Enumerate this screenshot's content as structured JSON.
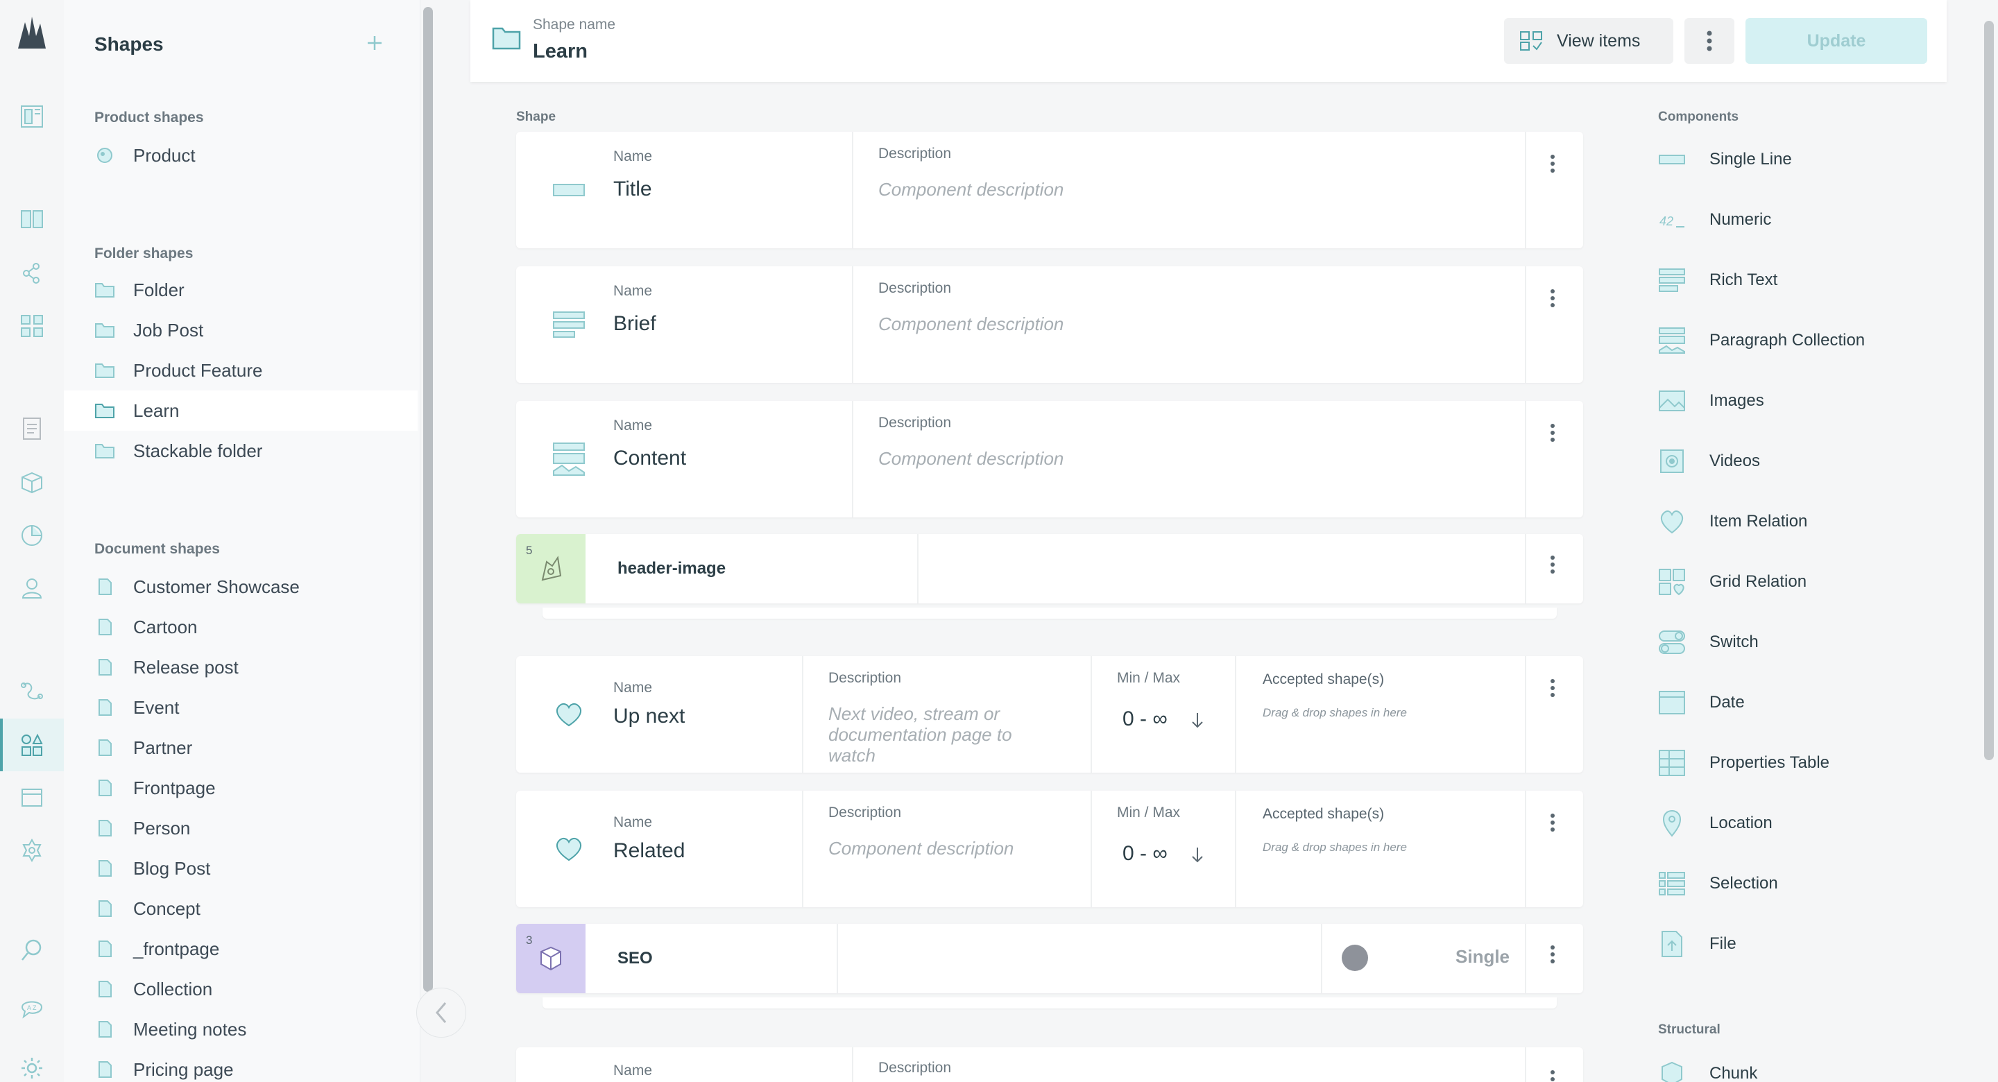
{
  "sidebar": {
    "title": "Shapes",
    "groups": [
      {
        "label": "Product shapes",
        "items": [
          {
            "label": "Product"
          }
        ]
      },
      {
        "label": "Folder shapes",
        "items": [
          {
            "label": "Folder"
          },
          {
            "label": "Job Post"
          },
          {
            "label": "Product Feature"
          },
          {
            "label": "Learn"
          },
          {
            "label": "Stackable folder"
          }
        ]
      },
      {
        "label": "Document shapes",
        "items": [
          {
            "label": "Customer Showcase"
          },
          {
            "label": "Cartoon"
          },
          {
            "label": "Release post"
          },
          {
            "label": "Event"
          },
          {
            "label": "Partner"
          },
          {
            "label": "Frontpage"
          },
          {
            "label": "Person"
          },
          {
            "label": "Blog Post"
          },
          {
            "label": "Concept"
          },
          {
            "label": "_frontpage"
          },
          {
            "label": "Collection"
          },
          {
            "label": "Meeting notes"
          },
          {
            "label": "Pricing page"
          }
        ]
      }
    ],
    "active_item": "Learn"
  },
  "header": {
    "shape_name_label": "Shape name",
    "shape_name": "Learn",
    "view_items_label": "View items",
    "update_label": "Update"
  },
  "main": {
    "shape_label": "Shape",
    "labels": {
      "name": "Name",
      "description": "Description",
      "minmax": "Min / Max",
      "accepted": "Accepted shape(s)",
      "component_description": "Component description",
      "drop_hint": "Drag & drop shapes in here"
    },
    "components": [
      {
        "name": "Title",
        "icon": "single-line-icon"
      },
      {
        "name": "Brief",
        "icon": "rich-text-icon"
      },
      {
        "name": "Content",
        "icon": "paragraph-collection-icon"
      },
      {
        "chunk_name": "header-image",
        "count": "5",
        "icon": "chunk-icon"
      },
      {
        "name": "Up next",
        "icon": "item-relation-icon",
        "description": "Next video, stream or documentation page to watch",
        "minmax": "0 - ∞"
      },
      {
        "name": "Related",
        "icon": "item-relation-icon",
        "minmax": "0 - ∞"
      },
      {
        "chunk_name": "SEO",
        "count": "3",
        "icon": "chunk-icon",
        "mode": "Single"
      }
    ]
  },
  "palette": {
    "components_label": "Components",
    "items": [
      {
        "label": "Single Line",
        "icon": "single-line-icon"
      },
      {
        "label": "Numeric",
        "icon": "numeric-icon"
      },
      {
        "label": "Rich Text",
        "icon": "rich-text-icon"
      },
      {
        "label": "Paragraph Collection",
        "icon": "paragraph-collection-icon"
      },
      {
        "label": "Images",
        "icon": "images-icon"
      },
      {
        "label": "Videos",
        "icon": "videos-icon"
      },
      {
        "label": "Item Relation",
        "icon": "item-relation-icon"
      },
      {
        "label": "Grid Relation",
        "icon": "grid-relation-icon"
      },
      {
        "label": "Switch",
        "icon": "switch-icon"
      },
      {
        "label": "Date",
        "icon": "date-icon"
      },
      {
        "label": "Properties Table",
        "icon": "properties-table-icon"
      },
      {
        "label": "Location",
        "icon": "location-icon"
      },
      {
        "label": "Selection",
        "icon": "selection-icon"
      },
      {
        "label": "File",
        "icon": "file-icon"
      }
    ],
    "structural_label": "Structural",
    "structural_items": [
      {
        "label": "Chunk",
        "icon": "chunk-icon"
      }
    ],
    "numeric_icon_text": "42"
  },
  "colors": {
    "accent": "#4ea3a9",
    "accent_light": "#d5f1f3",
    "chunk_green": "#d9f2cf",
    "chunk_purple": "#d4cdf2"
  }
}
